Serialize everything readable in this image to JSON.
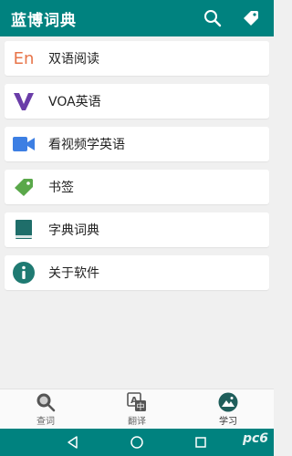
{
  "appbar": {
    "title": "蓝博词典",
    "search_icon": "search-icon",
    "bookmark_icon": "tag-icon"
  },
  "menu": {
    "items": [
      {
        "label": "双语阅读",
        "icon": "En",
        "icon_color": "#e8754a"
      },
      {
        "label": "VOA英语",
        "icon": "V",
        "icon_color": "#6a3da8"
      },
      {
        "label": "看视频学英语",
        "icon": "video-camera-icon",
        "icon_color": "#3d7fe3"
      },
      {
        "label": "书签",
        "icon": "tag-icon",
        "icon_color": "#5aa84a"
      },
      {
        "label": "字典词典",
        "icon": "book-icon",
        "icon_color": "#1f6e6a"
      },
      {
        "label": "关于软件",
        "icon": "info-icon",
        "icon_color": "#1f7a72"
      }
    ]
  },
  "bottom_nav": {
    "tabs": [
      {
        "label": "查词",
        "icon": "magnifier-icon",
        "active": false
      },
      {
        "label": "翻译",
        "icon": "translate-icon",
        "active": false
      },
      {
        "label": "学习",
        "icon": "landscape-icon",
        "active": true
      }
    ]
  },
  "watermark": {
    "text": "pc6"
  },
  "colors": {
    "primary": "#00827f",
    "background": "#f0f0f0"
  }
}
